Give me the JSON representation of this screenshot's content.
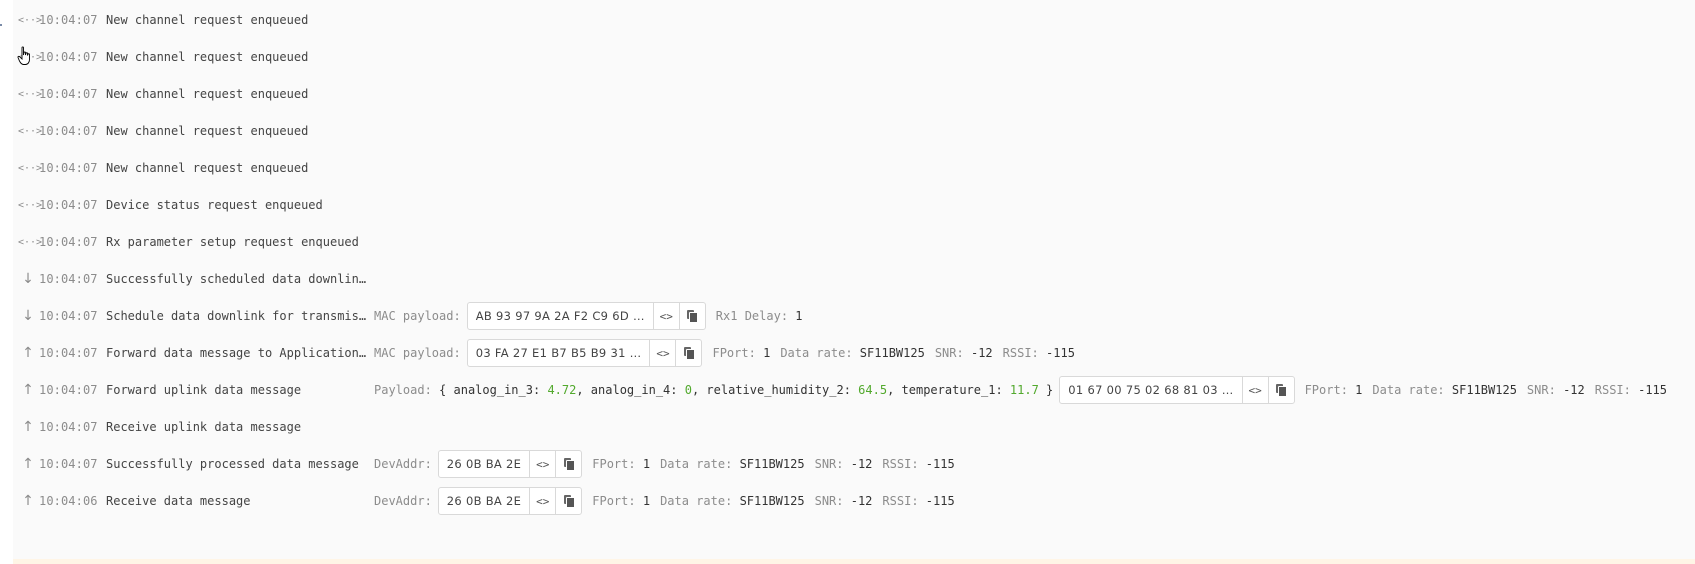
{
  "events": [
    {
      "icon": "mac-command-icon",
      "icon_glyph": "<··>",
      "time": "10:04:07",
      "message": "New channel request enqueued"
    },
    {
      "icon": "mac-command-icon",
      "icon_glyph": "<··>",
      "time": "10:04:07",
      "message": "New channel request enqueued"
    },
    {
      "icon": "mac-command-icon",
      "icon_glyph": "<··>",
      "time": "10:04:07",
      "message": "New channel request enqueued"
    },
    {
      "icon": "mac-command-icon",
      "icon_glyph": "<··>",
      "time": "10:04:07",
      "message": "New channel request enqueued"
    },
    {
      "icon": "mac-command-icon",
      "icon_glyph": "<··>",
      "time": "10:04:07",
      "message": "New channel request enqueued"
    },
    {
      "icon": "mac-command-icon",
      "icon_glyph": "<··>",
      "time": "10:04:07",
      "message": "Device status request enqueued"
    },
    {
      "icon": "mac-command-icon",
      "icon_glyph": "<··>",
      "time": "10:04:07",
      "message": "Rx parameter setup request enqueued"
    },
    {
      "icon": "arrow-down-icon",
      "icon_glyph": "↓",
      "time": "10:04:07",
      "message": "Successfully scheduled data downlink …"
    },
    {
      "icon": "arrow-down-icon",
      "icon_glyph": "↓",
      "time": "10:04:07",
      "message": "Schedule data downlink for transmissi…",
      "details": {
        "box_label": "MAC payload:",
        "box_value": "AB 93 97 9A 2A F2 C9 6D …",
        "fields": [
          {
            "label": "Rx1 Delay:",
            "value": "1"
          }
        ]
      }
    },
    {
      "icon": "arrow-up-icon",
      "icon_glyph": "↑",
      "time": "10:04:07",
      "message": "Forward data message to Application S…",
      "details": {
        "box_label": "MAC payload:",
        "box_value": "03 FA 27 E1 B7 B5 B9 31 …",
        "fields": [
          {
            "label": "FPort:",
            "value": "1"
          },
          {
            "label": "Data rate:",
            "value": "SF11BW125"
          },
          {
            "label": "SNR:",
            "value": "-12"
          },
          {
            "label": "RSSI:",
            "value": "-115"
          }
        ]
      }
    },
    {
      "icon": "arrow-up-icon",
      "icon_glyph": "↑",
      "time": "10:04:07",
      "message": "Forward uplink data message",
      "payload": {
        "label": "Payload:",
        "open": "{",
        "close": "}",
        "entries": [
          {
            "key": "analog_in_3",
            "value": "4.72"
          },
          {
            "key": "analog_in_4",
            "value": "0"
          },
          {
            "key": "relative_humidity_2",
            "value": "64.5"
          },
          {
            "key": "temperature_1",
            "value": "11.7"
          }
        ]
      },
      "details": {
        "box_label": "",
        "box_value": "01 67 00 75 02 68 81 03 …",
        "fields": [
          {
            "label": "FPort:",
            "value": "1"
          },
          {
            "label": "Data rate:",
            "value": "SF11BW125"
          },
          {
            "label": "SNR:",
            "value": "-12"
          },
          {
            "label": "RSSI:",
            "value": "-115"
          }
        ]
      }
    },
    {
      "icon": "arrow-up-icon",
      "icon_glyph": "↑",
      "time": "10:04:07",
      "message": "Receive uplink data message"
    },
    {
      "icon": "arrow-up-icon",
      "icon_glyph": "↑",
      "time": "10:04:07",
      "message": "Successfully processed data message",
      "details": {
        "box_label": "DevAddr:",
        "box_value": "26 0B BA 2E",
        "fields": [
          {
            "label": "FPort:",
            "value": "1"
          },
          {
            "label": "Data rate:",
            "value": "SF11BW125"
          },
          {
            "label": "SNR:",
            "value": "-12"
          },
          {
            "label": "RSSI:",
            "value": "-115"
          }
        ]
      }
    },
    {
      "icon": "arrow-up-icon",
      "icon_glyph": "↑",
      "time": "10:04:06",
      "message": "Receive data message",
      "details": {
        "box_label": "DevAddr:",
        "box_value": "26 0B BA 2E",
        "fields": [
          {
            "label": "FPort:",
            "value": "1"
          },
          {
            "label": "Data rate:",
            "value": "SF11BW125"
          },
          {
            "label": "SNR:",
            "value": "-12"
          },
          {
            "label": "RSSI:",
            "value": "-115"
          }
        ]
      }
    }
  ],
  "buttons": {
    "toggle_format_glyph": "<>"
  },
  "colors": {
    "payload_number": "#52a92d",
    "label": "#8c8c8c",
    "highlight_strip": "#fff5e6"
  }
}
